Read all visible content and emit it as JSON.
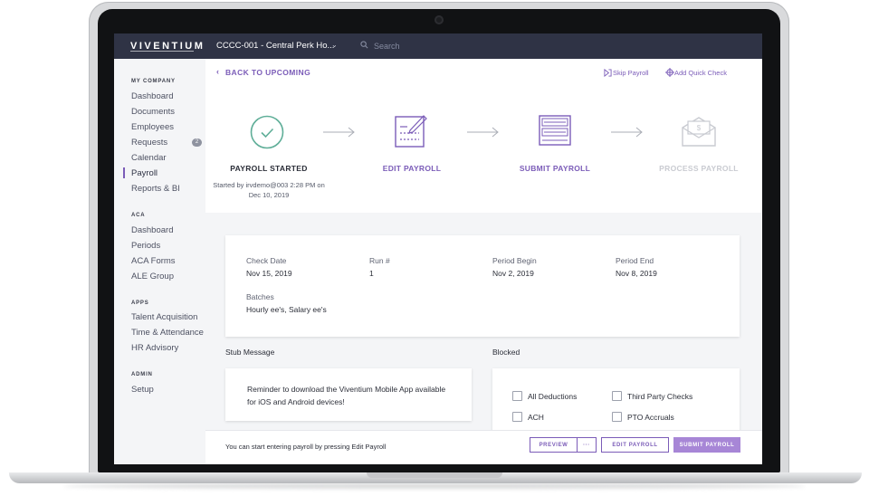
{
  "app": {
    "logo": "VIVENTIUM"
  },
  "topbar": {
    "company": "CCCC-001 - Central Perk Ho...",
    "company_chevron": "⌄",
    "search_placeholder": "Search"
  },
  "sidebar": {
    "sections": [
      {
        "title": "MY COMPANY",
        "items": [
          "Dashboard",
          "Documents",
          "Employees",
          "Requests",
          "Calendar",
          "Payroll",
          "Reports & BI"
        ]
      },
      {
        "title": "ACA",
        "items": [
          "Dashboard",
          "Periods",
          "ACA Forms",
          "ALE Group"
        ]
      },
      {
        "title": "APPS",
        "items": [
          "Talent Acquisition",
          "Time & Attendance",
          "HR Advisory"
        ]
      },
      {
        "title": "ADMIN",
        "items": [
          "Setup"
        ]
      }
    ],
    "requests_badge": "2",
    "active_item": "Payroll"
  },
  "header": {
    "back_label": "BACK TO UPCOMING",
    "back_chevron": "‹",
    "skip_label": "Skip Payroll",
    "add_check_label": "Add Quick Check"
  },
  "steps": [
    {
      "label": "PAYROLL STARTED",
      "status": "done",
      "icon": "check-circle-icon"
    },
    {
      "label": "EDIT PAYROLL",
      "status": "active",
      "icon": "edit-form-icon"
    },
    {
      "label": "SUBMIT PAYROLL",
      "status": "active",
      "icon": "submit-ledger-icon"
    },
    {
      "label": "PROCESS PAYROLL",
      "status": "pending",
      "icon": "envelope-money-icon"
    }
  ],
  "step_meta": {
    "line1": "Started by irvdemo@003 2:28 PM on",
    "line2": "Dec 10, 2019"
  },
  "details": {
    "check_date_label": "Check Date",
    "check_date": "Nov 15, 2019",
    "run_label": "Run #",
    "run": "1",
    "period_begin_label": "Period Begin",
    "period_begin": "Nov 2, 2019",
    "period_end_label": "Period End",
    "period_end": "Nov 8, 2019",
    "batches_label": "Batches",
    "batches": "Hourly ee's, Salary ee's"
  },
  "stub": {
    "title": "Stub Message",
    "text": "Reminder to download the Viventium Mobile App available for iOS and Android devices!"
  },
  "blocked": {
    "title": "Blocked",
    "options": [
      "All Deductions",
      "Third Party Checks",
      "ACH",
      "PTO Accruals"
    ]
  },
  "footer": {
    "message": "You can start entering payroll by pressing Edit Payroll",
    "preview": "PREVIEW",
    "more": "···",
    "edit": "EDIT PAYROLL",
    "submit": "SUBMIT PAYROLL"
  },
  "colors": {
    "accent": "#7b5cb8",
    "topbar": "#2f3345",
    "success": "#5fae98",
    "pending": "#c9cbd1"
  }
}
